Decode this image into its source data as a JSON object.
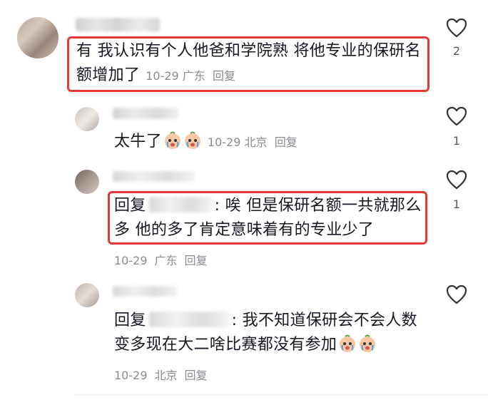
{
  "comments": [
    {
      "text": "有 我认识有个人他爸和学院熟 将他专业的保研名额增加了",
      "date": "10-29",
      "location": "广东",
      "reply_label": "回复",
      "likes": "2"
    },
    {
      "text": "太牛了",
      "date": "10-29",
      "location": "北京",
      "reply_label": "回复",
      "likes": "1"
    },
    {
      "prefix": "回复",
      "text": ": 唉 但是保研名额一共就那么多 他的多了肯定意味着有的专业少了",
      "date": "10-29",
      "location": "广东",
      "reply_label": "回复",
      "likes": "1"
    },
    {
      "prefix": "回复",
      "text": ": 我不知道保研会不会人数变多现在大二啥比赛都没有参加",
      "date": "10-29",
      "location": "北京",
      "reply_label": "回复"
    }
  ],
  "icons": {
    "like": "heart-outline-icon",
    "emoji": "crying-face-emoji"
  },
  "colors": {
    "highlight": "#e53935",
    "meta": "#8a8b91",
    "text": "#161823"
  }
}
